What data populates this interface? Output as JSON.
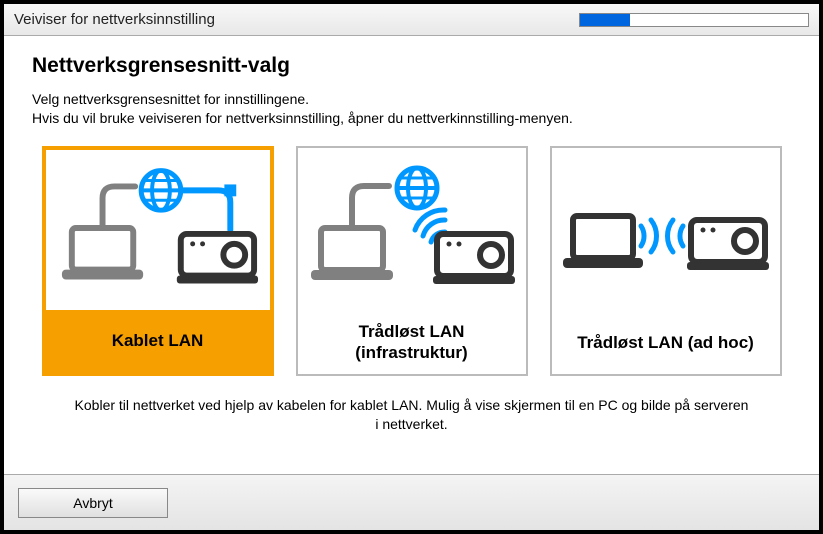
{
  "titlebar": {
    "title": "Veiviser for nettverksinnstilling"
  },
  "progress": {
    "percent": 22
  },
  "page": {
    "heading": "Nettverksgrensesnitt-valg",
    "instruction_line1": "Velg nettverksgrensesnittet for innstillingene.",
    "instruction_line2": "Hvis du vil bruke veiviseren for nettverksinnstilling, åpner du nettverkinnstilling-menyen."
  },
  "options": {
    "wired": {
      "label": "Kablet LAN"
    },
    "wireless_infra": {
      "label": "Trådløst LAN (infrastruktur)"
    },
    "wireless_adhoc": {
      "label": "Trådløst LAN (ad hoc)"
    }
  },
  "description": "Kobler til nettverket ved hjelp av kabelen for kablet LAN. Mulig å vise skjermen til en PC og bilde på serveren i nettverket.",
  "footer": {
    "cancel": "Avbryt"
  },
  "colors": {
    "accent": "#f5a000",
    "link_blue": "#0098ff",
    "gray": "#808080"
  }
}
